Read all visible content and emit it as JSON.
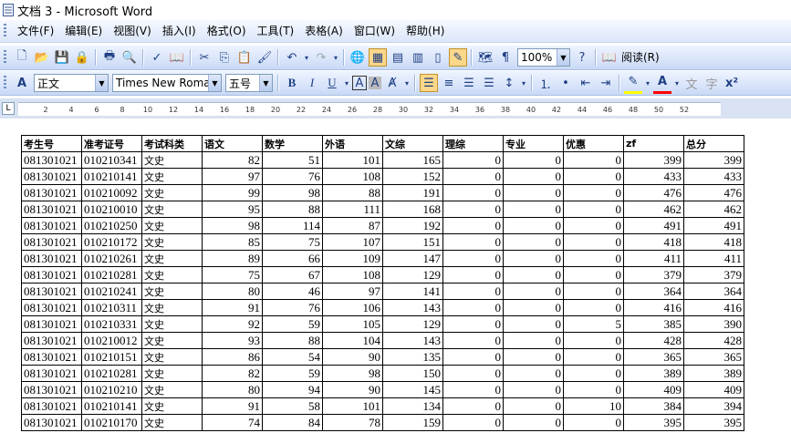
{
  "window": {
    "title": "文档 3 - Microsoft Word"
  },
  "menu": [
    "文件(F)",
    "编辑(E)",
    "视图(V)",
    "插入(I)",
    "格式(O)",
    "工具(T)",
    "表格(A)",
    "窗口(W)",
    "帮助(H)"
  ],
  "toolbar1": {
    "zoom": "100%",
    "read_label": "阅读(R)"
  },
  "toolbar2": {
    "style": "正文",
    "font": "Times New Roman",
    "size": "五号"
  },
  "ruler": {
    "marks": [
      "2",
      "4",
      "6",
      "8",
      "10",
      "12",
      "14",
      "16",
      "18",
      "20",
      "22",
      "24",
      "26",
      "28",
      "30",
      "32",
      "34",
      "36",
      "38",
      "40",
      "42",
      "44",
      "46",
      "48",
      "50",
      "52"
    ]
  },
  "table": {
    "headers": [
      "考生号",
      "准考证号",
      "考试科类",
      "语文",
      "数学",
      "外语",
      "文综",
      "理综",
      "专业",
      "优惠",
      "zf",
      "总分"
    ],
    "rows": [
      [
        "081301021",
        "010210341",
        "文史",
        "82",
        "51",
        "101",
        "165",
        "0",
        "0",
        "0",
        "399",
        "399"
      ],
      [
        "081301021",
        "010210141",
        "文史",
        "97",
        "76",
        "108",
        "152",
        "0",
        "0",
        "0",
        "433",
        "433"
      ],
      [
        "081301021",
        "010210092",
        "文史",
        "99",
        "98",
        "88",
        "191",
        "0",
        "0",
        "0",
        "476",
        "476"
      ],
      [
        "081301021",
        "010210010",
        "文史",
        "95",
        "88",
        "111",
        "168",
        "0",
        "0",
        "0",
        "462",
        "462"
      ],
      [
        "081301021",
        "010210250",
        "文史",
        "98",
        "114",
        "87",
        "192",
        "0",
        "0",
        "0",
        "491",
        "491"
      ],
      [
        "081301021",
        "010210172",
        "文史",
        "85",
        "75",
        "107",
        "151",
        "0",
        "0",
        "0",
        "418",
        "418"
      ],
      [
        "081301021",
        "010210261",
        "文史",
        "89",
        "66",
        "109",
        "147",
        "0",
        "0",
        "0",
        "411",
        "411"
      ],
      [
        "081301021",
        "010210281",
        "文史",
        "75",
        "67",
        "108",
        "129",
        "0",
        "0",
        "0",
        "379",
        "379"
      ],
      [
        "081301021",
        "010210241",
        "文史",
        "80",
        "46",
        "97",
        "141",
        "0",
        "0",
        "0",
        "364",
        "364"
      ],
      [
        "081301021",
        "010210311",
        "文史",
        "91",
        "76",
        "106",
        "143",
        "0",
        "0",
        "0",
        "416",
        "416"
      ],
      [
        "081301021",
        "010210331",
        "文史",
        "92",
        "59",
        "105",
        "129",
        "0",
        "0",
        "5",
        "385",
        "390"
      ],
      [
        "081301021",
        "010210012",
        "文史",
        "93",
        "88",
        "104",
        "143",
        "0",
        "0",
        "0",
        "428",
        "428"
      ],
      [
        "081301021",
        "010210151",
        "文史",
        "86",
        "54",
        "90",
        "135",
        "0",
        "0",
        "0",
        "365",
        "365"
      ],
      [
        "081301021",
        "010210281",
        "文史",
        "82",
        "59",
        "98",
        "150",
        "0",
        "0",
        "0",
        "389",
        "389"
      ],
      [
        "081301021",
        "010210210",
        "文史",
        "80",
        "94",
        "90",
        "145",
        "0",
        "0",
        "0",
        "409",
        "409"
      ],
      [
        "081301021",
        "010210141",
        "文史",
        "91",
        "58",
        "101",
        "134",
        "0",
        "0",
        "10",
        "384",
        "394"
      ],
      [
        "081301021",
        "010210170",
        "文史",
        "74",
        "84",
        "78",
        "159",
        "0",
        "0",
        "0",
        "395",
        "395"
      ]
    ]
  }
}
